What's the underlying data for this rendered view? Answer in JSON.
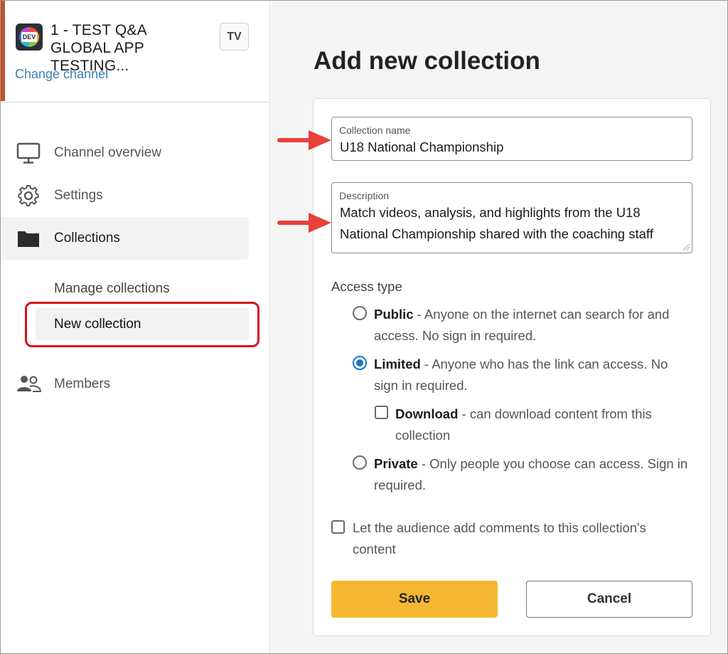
{
  "channel": {
    "logo_text": "DEV",
    "name": "1 - TEST Q&A GLOBAL APP TESTING...",
    "badge": "TV",
    "change_label": "Change channel"
  },
  "nav": {
    "overview": "Channel overview",
    "settings": "Settings",
    "collections": "Collections",
    "manage_collections": "Manage collections",
    "new_collection": "New collection",
    "members": "Members"
  },
  "page": {
    "title": "Add new collection"
  },
  "form": {
    "name_label": "Collection name",
    "name_value": "U18 National Championship",
    "description_label": "Description",
    "description_value": "Match videos, analysis, and highlights from the U18 National Championship shared with the coaching staff",
    "access_type_label": "Access type",
    "options": {
      "public_title": "Public",
      "public_desc": " - Anyone on the internet can search for and access. No sign in required.",
      "limited_title": "Limited",
      "limited_desc": " - Anyone who has the link can access. No sign in required.",
      "download_title": "Download",
      "download_desc": " - can download content from this collection",
      "private_title": "Private",
      "private_desc": " - Only people you choose can access. Sign in required."
    },
    "selected_access": "Limited",
    "download_checked": false,
    "comments_label": "Let the audience add comments to this collection's content",
    "comments_checked": false,
    "save_label": "Save",
    "cancel_label": "Cancel"
  },
  "colors": {
    "accent": "#f5b731",
    "link": "#3b7fb5",
    "radio_selected": "#1a73c8",
    "highlight_box": "#d6111f",
    "arrow": "#e8403a",
    "channel_accent": "#c0532b"
  },
  "icons": {
    "overview": "monitor-icon",
    "settings": "gear-icon",
    "collections": "folder-icon",
    "members": "people-icon"
  }
}
